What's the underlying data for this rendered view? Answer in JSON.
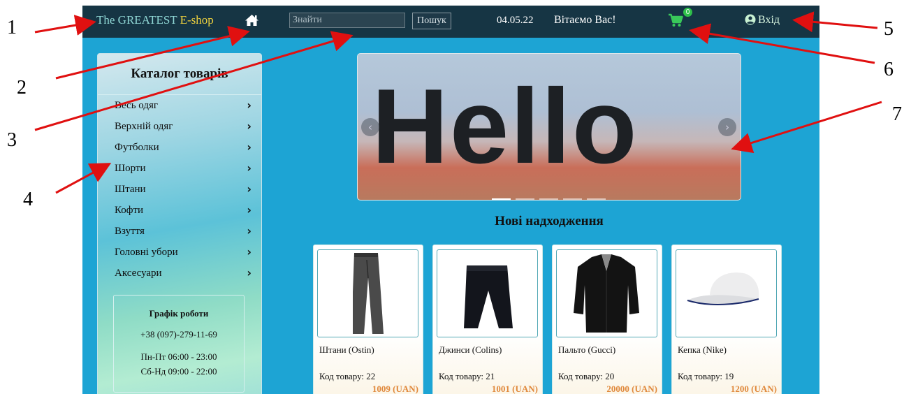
{
  "callouts": [
    "1",
    "2",
    "3",
    "4",
    "5",
    "6",
    "7"
  ],
  "navbar": {
    "brand_part1": "The GREATEST ",
    "brand_part2": "E-shop",
    "home_icon": "home-icon",
    "search_placeholder": "Знайти",
    "search_button": "Пошук",
    "date": "04.05.22",
    "welcome": "Вітаємо Вас!",
    "cart_icon": "shopping-cart-icon",
    "cart_count": "0",
    "login_label": "Вхід",
    "login_icon": "user-circle-icon"
  },
  "sidebar": {
    "title": "Каталог товарів",
    "items": [
      {
        "label": "Весь одяг"
      },
      {
        "label": "Верхній одяг"
      },
      {
        "label": "Футболки"
      },
      {
        "label": "Шорти"
      },
      {
        "label": "Штани"
      },
      {
        "label": "Кофти"
      },
      {
        "label": "Взуття"
      },
      {
        "label": "Головні убори"
      },
      {
        "label": "Аксесуари"
      }
    ],
    "chevron": "›",
    "schedule": {
      "title": "Графік роботи",
      "phone": "+38 (097)-279-11-69",
      "line1": "Пн-Пт 06:00 - 23:00",
      "line2": "Сб-Нд 09:00 - 22:00"
    }
  },
  "carousel": {
    "slide_text": "Hello",
    "prev": "‹",
    "next": "›",
    "indicators": 5,
    "active_index": 0
  },
  "section_title": "Нові надходження",
  "products": [
    {
      "name": "Штани (Ostin)",
      "code": "Код товару: 22",
      "price": "1009 (UAN)",
      "image": "trousers"
    },
    {
      "name": "Джинси (Colins)",
      "code": "Код товару: 21",
      "price": "1001 (UAN)",
      "image": "jeans"
    },
    {
      "name": "Пальто (Gucci)",
      "code": "Код товару: 20",
      "price": "20000 (UAN)",
      "image": "coat"
    },
    {
      "name": "Кепка (Nike)",
      "code": "Код товару: 19",
      "price": "1200 (UAN)",
      "image": "cap"
    }
  ],
  "colors": {
    "background": "#1da4d4",
    "navbar": "#163544",
    "price": "#e0893c",
    "cart_badge": "#2fc04a"
  }
}
